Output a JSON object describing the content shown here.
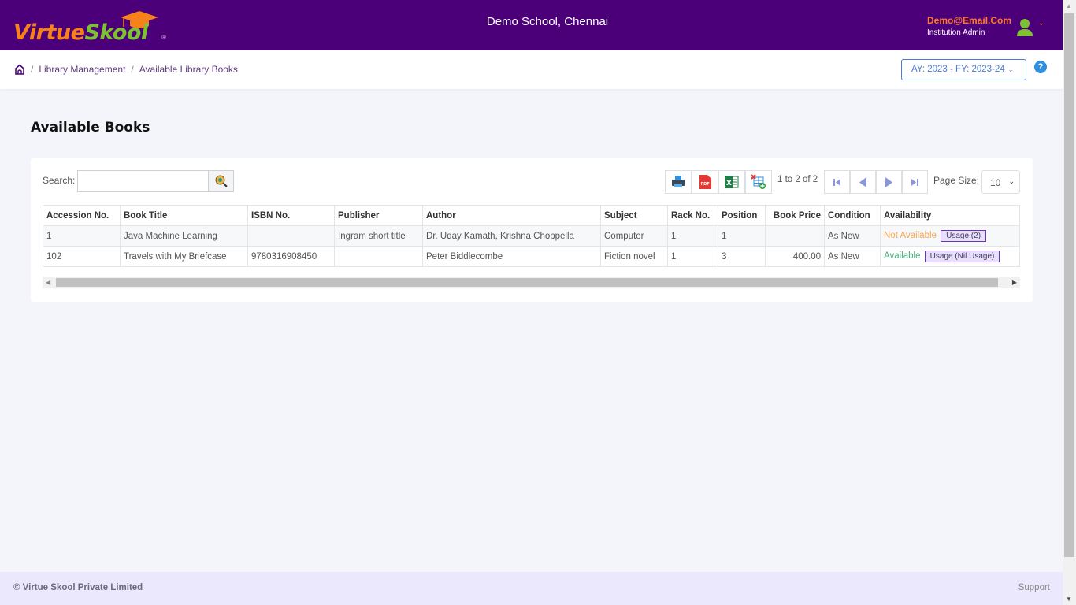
{
  "header": {
    "logo_part1": "Virtue",
    "logo_part2": "Skool",
    "logo_reg": "®",
    "school_name": "Demo School, Chennai",
    "user_email": "Demo@Email.Com",
    "user_role": "Institution Admin"
  },
  "breadcrumb": {
    "items": [
      "Library Management",
      "Available Library Books"
    ],
    "separator": "/"
  },
  "year_selector": {
    "value": "AY: 2023 - FY: 2023-24"
  },
  "help": "?",
  "page_title": "Available Books",
  "toolbar": {
    "search_label": "Search:",
    "search_value": "",
    "paging_info": "1 to 2 of 2",
    "page_size_label": "Page Size:",
    "page_size_value": "10",
    "icons": [
      "print-icon",
      "pdf-icon",
      "excel-icon",
      "column-chooser-icon"
    ]
  },
  "table": {
    "columns": [
      "Accession No.",
      "Book Title",
      "ISBN No.",
      "Publisher",
      "Author",
      "Subject",
      "Rack No.",
      "Position",
      "Book Price",
      "Condition",
      "Availability"
    ],
    "rows": [
      {
        "accession": "1",
        "title": "Java Machine Learning",
        "isbn": "",
        "publisher": "Ingram short title",
        "author": "Dr. Uday Kamath, Krishna Choppella",
        "subject": "Computer",
        "rack": "1",
        "position": "1",
        "price": "",
        "condition": "As New",
        "availability": "Not Available",
        "usage": "Usage (2)"
      },
      {
        "accession": "102",
        "title": "Travels with My Briefcase",
        "isbn": "9780316908450",
        "publisher": "",
        "author": "Peter Biddlecombe",
        "subject": "Fiction novel",
        "rack": "1",
        "position": "3",
        "price": "400.00",
        "condition": "As New",
        "availability": "Available",
        "usage": "Usage (Nil Usage)"
      }
    ]
  },
  "footer": {
    "copyright": "© Virtue Skool Private Limited",
    "support": "Support"
  },
  "colors": {
    "header_bg": "#4b0079",
    "brand_orange": "#f7821b",
    "brand_green": "#7ec232",
    "not_available": "#f7a752",
    "available": "#4bae7b",
    "footer_bg": "#ebe7fd"
  }
}
